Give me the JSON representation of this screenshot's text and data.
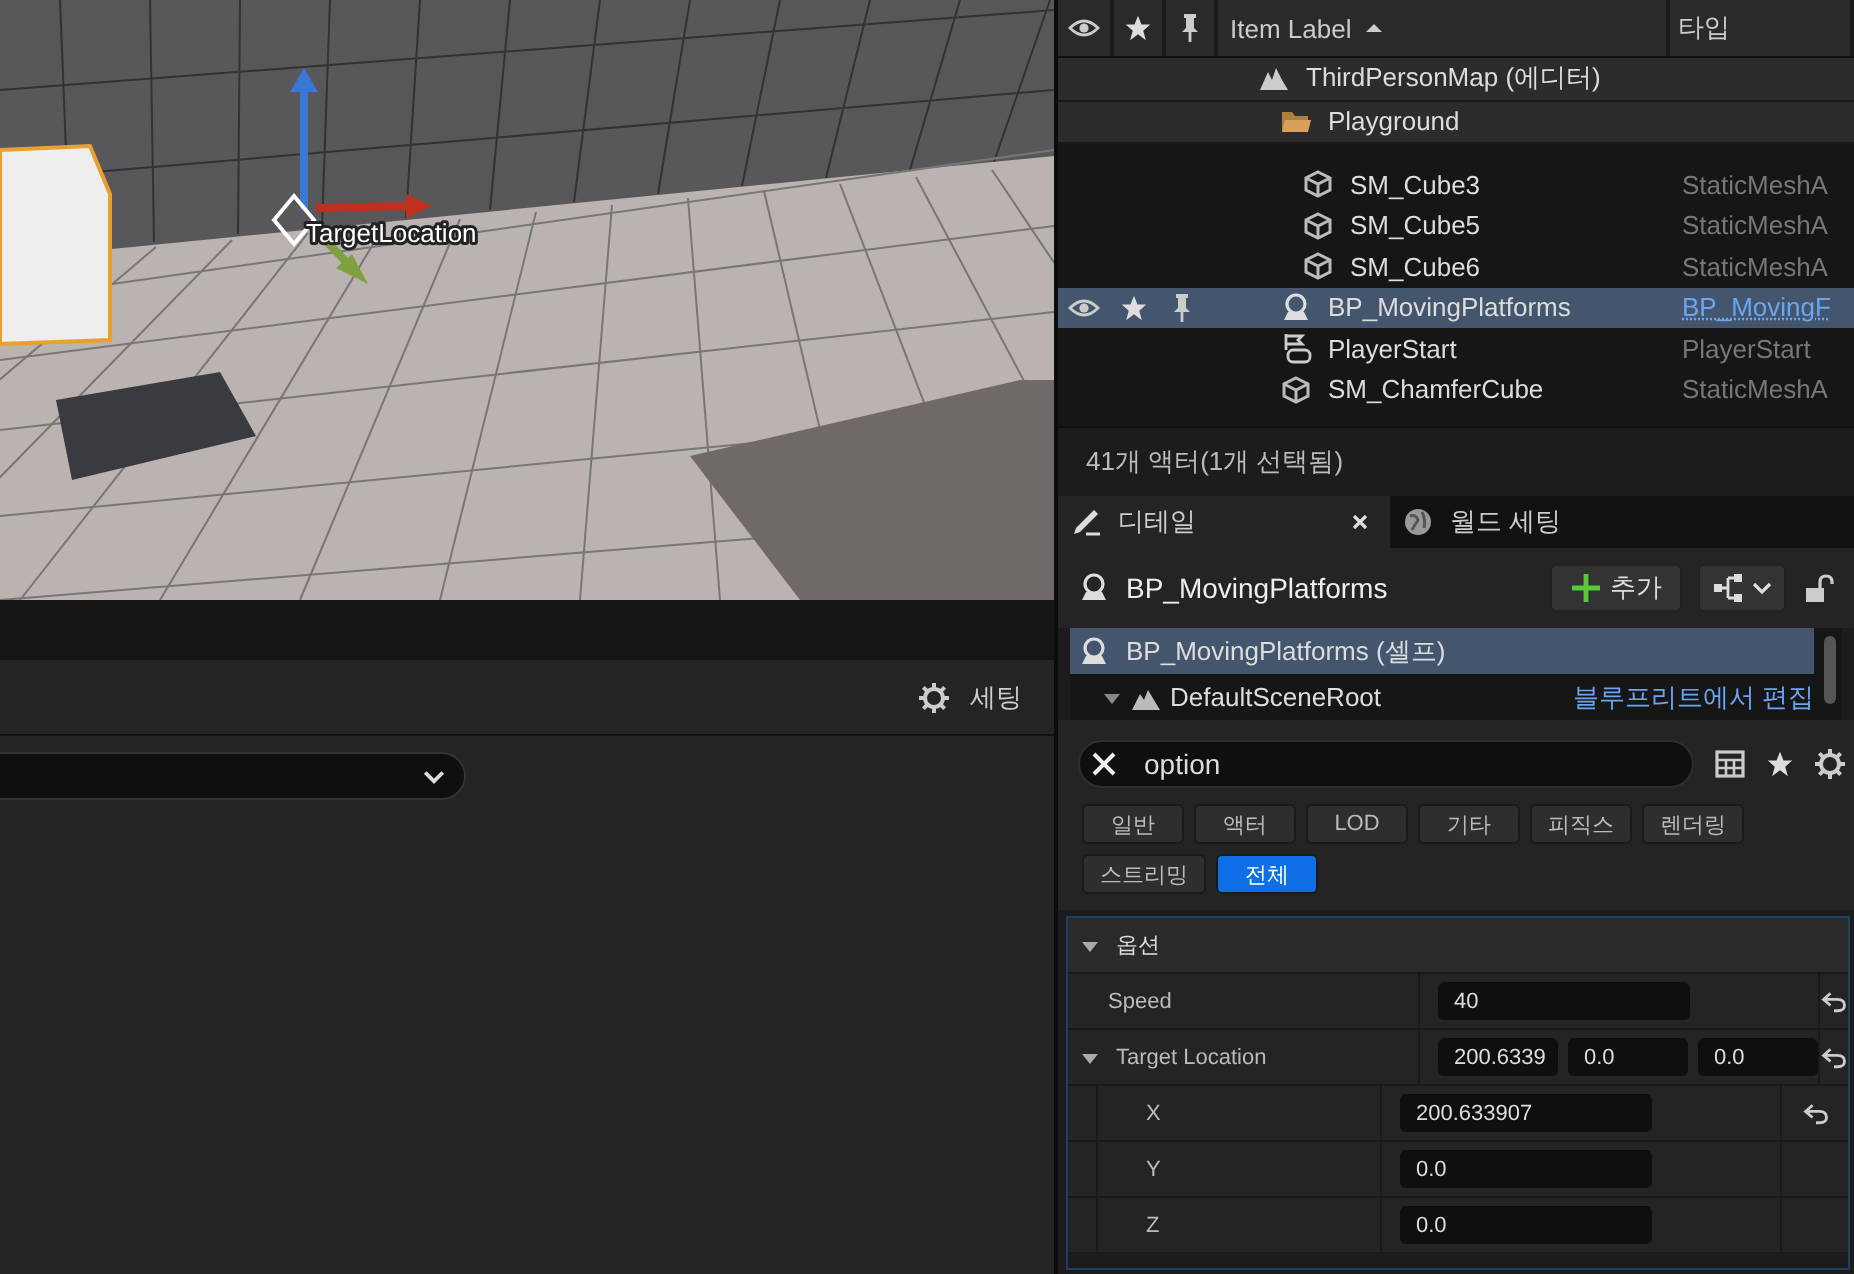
{
  "viewport": {
    "actor_label": "TargetLocation"
  },
  "bottom_panel": {
    "settings_label": "세팅"
  },
  "outliner": {
    "columns": {
      "label": "Item Label",
      "type": "타입"
    },
    "items": [
      {
        "kind": "map",
        "label": "ThirdPersonMap (에디터)",
        "pinned": true,
        "selected": false,
        "children": [
          {
            "kind": "folder",
            "label": "Playground",
            "pinned": true,
            "selected": false,
            "children": [
              {
                "kind": "mesh",
                "label": "SM_Cube3",
                "type": "StaticMeshA",
                "pinned": false,
                "selected": false
              },
              {
                "kind": "mesh",
                "label": "SM_Cube5",
                "type": "StaticMeshA",
                "pinned": false,
                "selected": false
              },
              {
                "kind": "mesh",
                "label": "SM_Cube6",
                "type": "StaticMeshA",
                "pinned": false,
                "selected": false
              }
            ]
          },
          {
            "kind": "blueprint",
            "label": "BP_MovingPlatforms",
            "type": "BP_MovingF",
            "pinned": false,
            "selected": true
          },
          {
            "kind": "player-start",
            "label": "PlayerStart",
            "type": "PlayerStart",
            "pinned": false,
            "selected": false
          },
          {
            "kind": "mesh",
            "label": "SM_ChamferCube",
            "type": "StaticMeshA",
            "pinned": false,
            "selected": false
          }
        ]
      }
    ],
    "status": "41개 액터(1개 선택됨)"
  },
  "details": {
    "tabs": [
      {
        "kind": "details",
        "label": "디테일",
        "selected": true,
        "closable": true
      },
      {
        "kind": "world",
        "label": "월드 세팅",
        "selected": false,
        "closable": false
      }
    ],
    "actor_name": "BP_MovingPlatforms",
    "add_label": "추가",
    "components": [
      {
        "kind": "blueprint",
        "label": "BP_MovingPlatforms (셀프)",
        "selected": true
      },
      {
        "kind": "scene",
        "label": "DefaultSceneRoot",
        "selected": false,
        "link": "블루프리트에서 편집"
      }
    ],
    "search": {
      "value": "option"
    },
    "filters": [
      {
        "label": "일반",
        "selected": false
      },
      {
        "label": "액터",
        "selected": false
      },
      {
        "label": "LOD",
        "selected": false
      },
      {
        "label": "기타",
        "selected": false
      },
      {
        "label": "피직스",
        "selected": false
      },
      {
        "label": "렌더링",
        "selected": false
      },
      {
        "label": "스트리밍",
        "selected": false
      },
      {
        "label": "전체",
        "selected": true
      }
    ],
    "category": {
      "label": "옵션",
      "expanded": true,
      "properties": [
        {
          "label": "Speed",
          "values": [
            "40"
          ],
          "reset": true
        },
        {
          "label": "Target Location",
          "values": [
            "200.6339",
            "0.0",
            "0.0"
          ],
          "reset": true,
          "expanded": true,
          "children": [
            {
              "label": "X",
              "values": [
                "200.633907"
              ],
              "reset": true
            },
            {
              "label": "Y",
              "values": [
                "0.0"
              ],
              "reset": false
            },
            {
              "label": "Z",
              "values": [
                "0.0"
              ],
              "reset": false
            }
          ]
        }
      ]
    }
  }
}
